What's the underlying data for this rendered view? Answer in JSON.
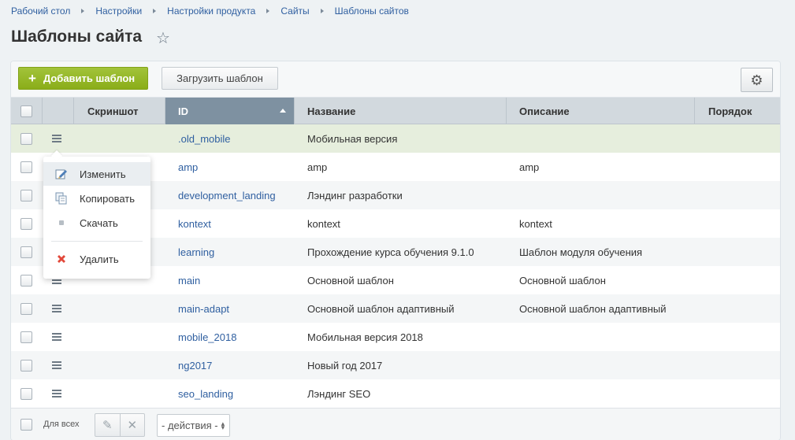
{
  "breadcrumb": [
    "Рабочий стол",
    "Настройки",
    "Настройки продукта",
    "Сайты",
    "Шаблоны сайтов"
  ],
  "page": {
    "title": "Шаблоны сайта"
  },
  "toolbar": {
    "add_label": "Добавить шаблон",
    "upload_label": "Загрузить шаблон"
  },
  "table": {
    "headers": {
      "screenshot": "Скриншот",
      "id": "ID",
      "name": "Название",
      "description": "Описание",
      "order": "Порядок"
    },
    "rows": [
      {
        "id": ".old_mobile",
        "name": "Мобильная версия",
        "description": ""
      },
      {
        "id": "amp",
        "name": "amp",
        "description": "amp"
      },
      {
        "id": "development_landing",
        "name": "Лэндинг разработки",
        "description": ""
      },
      {
        "id": "kontext",
        "name": "kontext",
        "description": "kontext"
      },
      {
        "id": "learning",
        "name": "Прохождение курса обучения 9.1.0",
        "description": "Шаблон модуля обучения"
      },
      {
        "id": "main",
        "name": "Основной шаблон",
        "description": "Основной шаблон"
      },
      {
        "id": "main-adapt",
        "name": "Основной шаблон адаптивный",
        "description": "Основной шаблон адаптивный"
      },
      {
        "id": "mobile_2018",
        "name": "Мобильная версия 2018",
        "description": ""
      },
      {
        "id": "ng2017",
        "name": "Новый год 2017",
        "description": ""
      },
      {
        "id": "seo_landing",
        "name": "Лэндинг SEO",
        "description": ""
      }
    ]
  },
  "context_menu": {
    "edit": "Изменить",
    "copy": "Копировать",
    "download": "Скачать",
    "delete": "Удалить"
  },
  "footer": {
    "for_all_label": "Для всех",
    "actions_select": "- действия -"
  },
  "colors": {
    "accent_green": "#8aad19",
    "link": "#2f5fa0",
    "sorted_header": "#7e91a1",
    "selected_row": "#e6eedd"
  }
}
